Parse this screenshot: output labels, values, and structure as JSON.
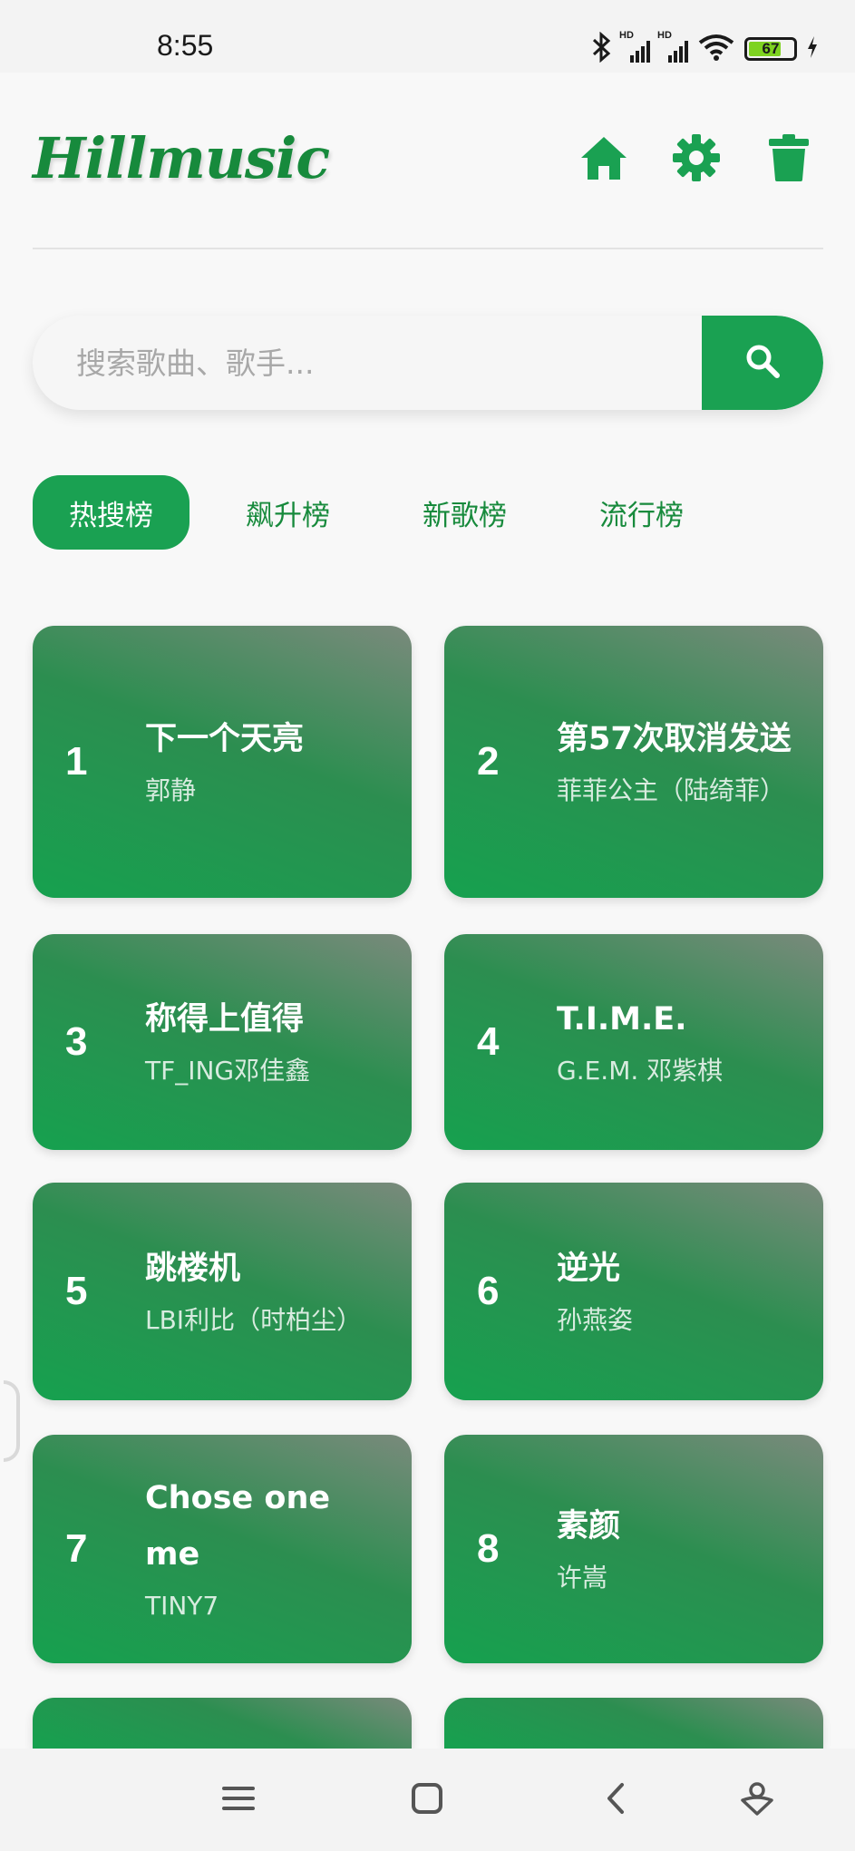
{
  "status_bar": {
    "time": "8:55",
    "battery_percent": "67",
    "signal_label_1": "HD",
    "signal_label_2": "HD"
  },
  "header": {
    "logo": "Hillmusic",
    "icons": [
      "home-icon",
      "gear-icon",
      "trash-icon"
    ]
  },
  "search": {
    "placeholder": "搜索歌曲、歌手..."
  },
  "tabs": [
    {
      "label": "热搜榜",
      "active": true
    },
    {
      "label": "飙升榜",
      "active": false
    },
    {
      "label": "新歌榜",
      "active": false
    },
    {
      "label": "流行榜",
      "active": false
    }
  ],
  "songs": [
    {
      "rank": "1",
      "title": "下一个天亮",
      "artist": "郭静"
    },
    {
      "rank": "2",
      "title": "第57次取消发送",
      "artist": "菲菲公主（陆绮菲）"
    },
    {
      "rank": "3",
      "title": "称得上值得",
      "artist": "TF_ING邓佳鑫"
    },
    {
      "rank": "4",
      "title": "T.I.M.E.",
      "artist": "G.E.M. 邓紫棋"
    },
    {
      "rank": "5",
      "title": "跳楼机",
      "artist": "LBI利比（时柏尘）"
    },
    {
      "rank": "6",
      "title": "逆光",
      "artist": "孙燕姿"
    },
    {
      "rank": "7",
      "title": "Chose one me",
      "artist": "TINY7"
    },
    {
      "rank": "8",
      "title": "素颜",
      "artist": "许嵩"
    }
  ],
  "colors": {
    "brand": "#178a3c",
    "accent": "#1aa152"
  },
  "nav_bar": {
    "icons": [
      "menu-icon",
      "home-square-icon",
      "back-icon",
      "assistant-icon"
    ]
  }
}
